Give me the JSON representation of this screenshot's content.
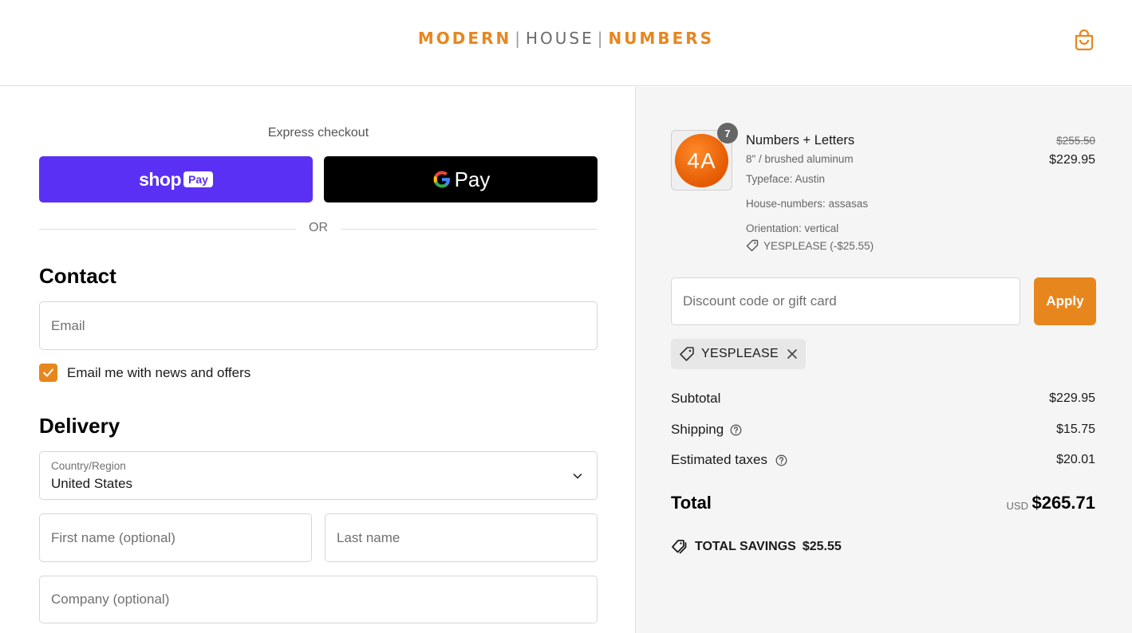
{
  "header": {
    "logo_part1": "MODERN",
    "logo_part2": "HOUSE",
    "logo_part3": "NUMBERS",
    "separator": "|",
    "cart_icon": "shopping-bag-icon",
    "accent_color": "#e8861e"
  },
  "express": {
    "title": "Express checkout",
    "shop_pay_word": "shop",
    "shop_pay_badge": "Pay",
    "gpay_label": "Pay",
    "or_label": "OR"
  },
  "contact": {
    "heading": "Contact",
    "email_placeholder": "Email",
    "newsletter_label": "Email me with news and offers",
    "newsletter_checked": true
  },
  "delivery": {
    "heading": "Delivery",
    "country_label": "Country/Region",
    "country_value": "United States",
    "first_name_placeholder": "First name (optional)",
    "last_name_placeholder": "Last name",
    "company_placeholder": "Company (optional)"
  },
  "order": {
    "item": {
      "thumb_text": "4A",
      "quantity": "7",
      "name": "Numbers + Letters",
      "variant": "8\" / brushed aluminum",
      "typeface": "Typeface: Austin",
      "house_numbers": "House-numbers: assasas",
      "orientation": "Orientation: vertical",
      "discount_tag": "YESPLEASE (-$25.55)",
      "price_original": "$255.50",
      "price_final": "$229.95"
    },
    "discount_placeholder": "Discount code or gift card",
    "apply_label": "Apply",
    "applied_code": "YESPLEASE",
    "subtotal_label": "Subtotal",
    "subtotal_value": "$229.95",
    "shipping_label": "Shipping",
    "shipping_value": "$15.75",
    "taxes_label": "Estimated taxes",
    "taxes_value": "$20.01",
    "total_label": "Total",
    "total_currency": "USD",
    "total_value": "$265.71",
    "savings_label": "TOTAL SAVINGS",
    "savings_value": "$25.55"
  }
}
